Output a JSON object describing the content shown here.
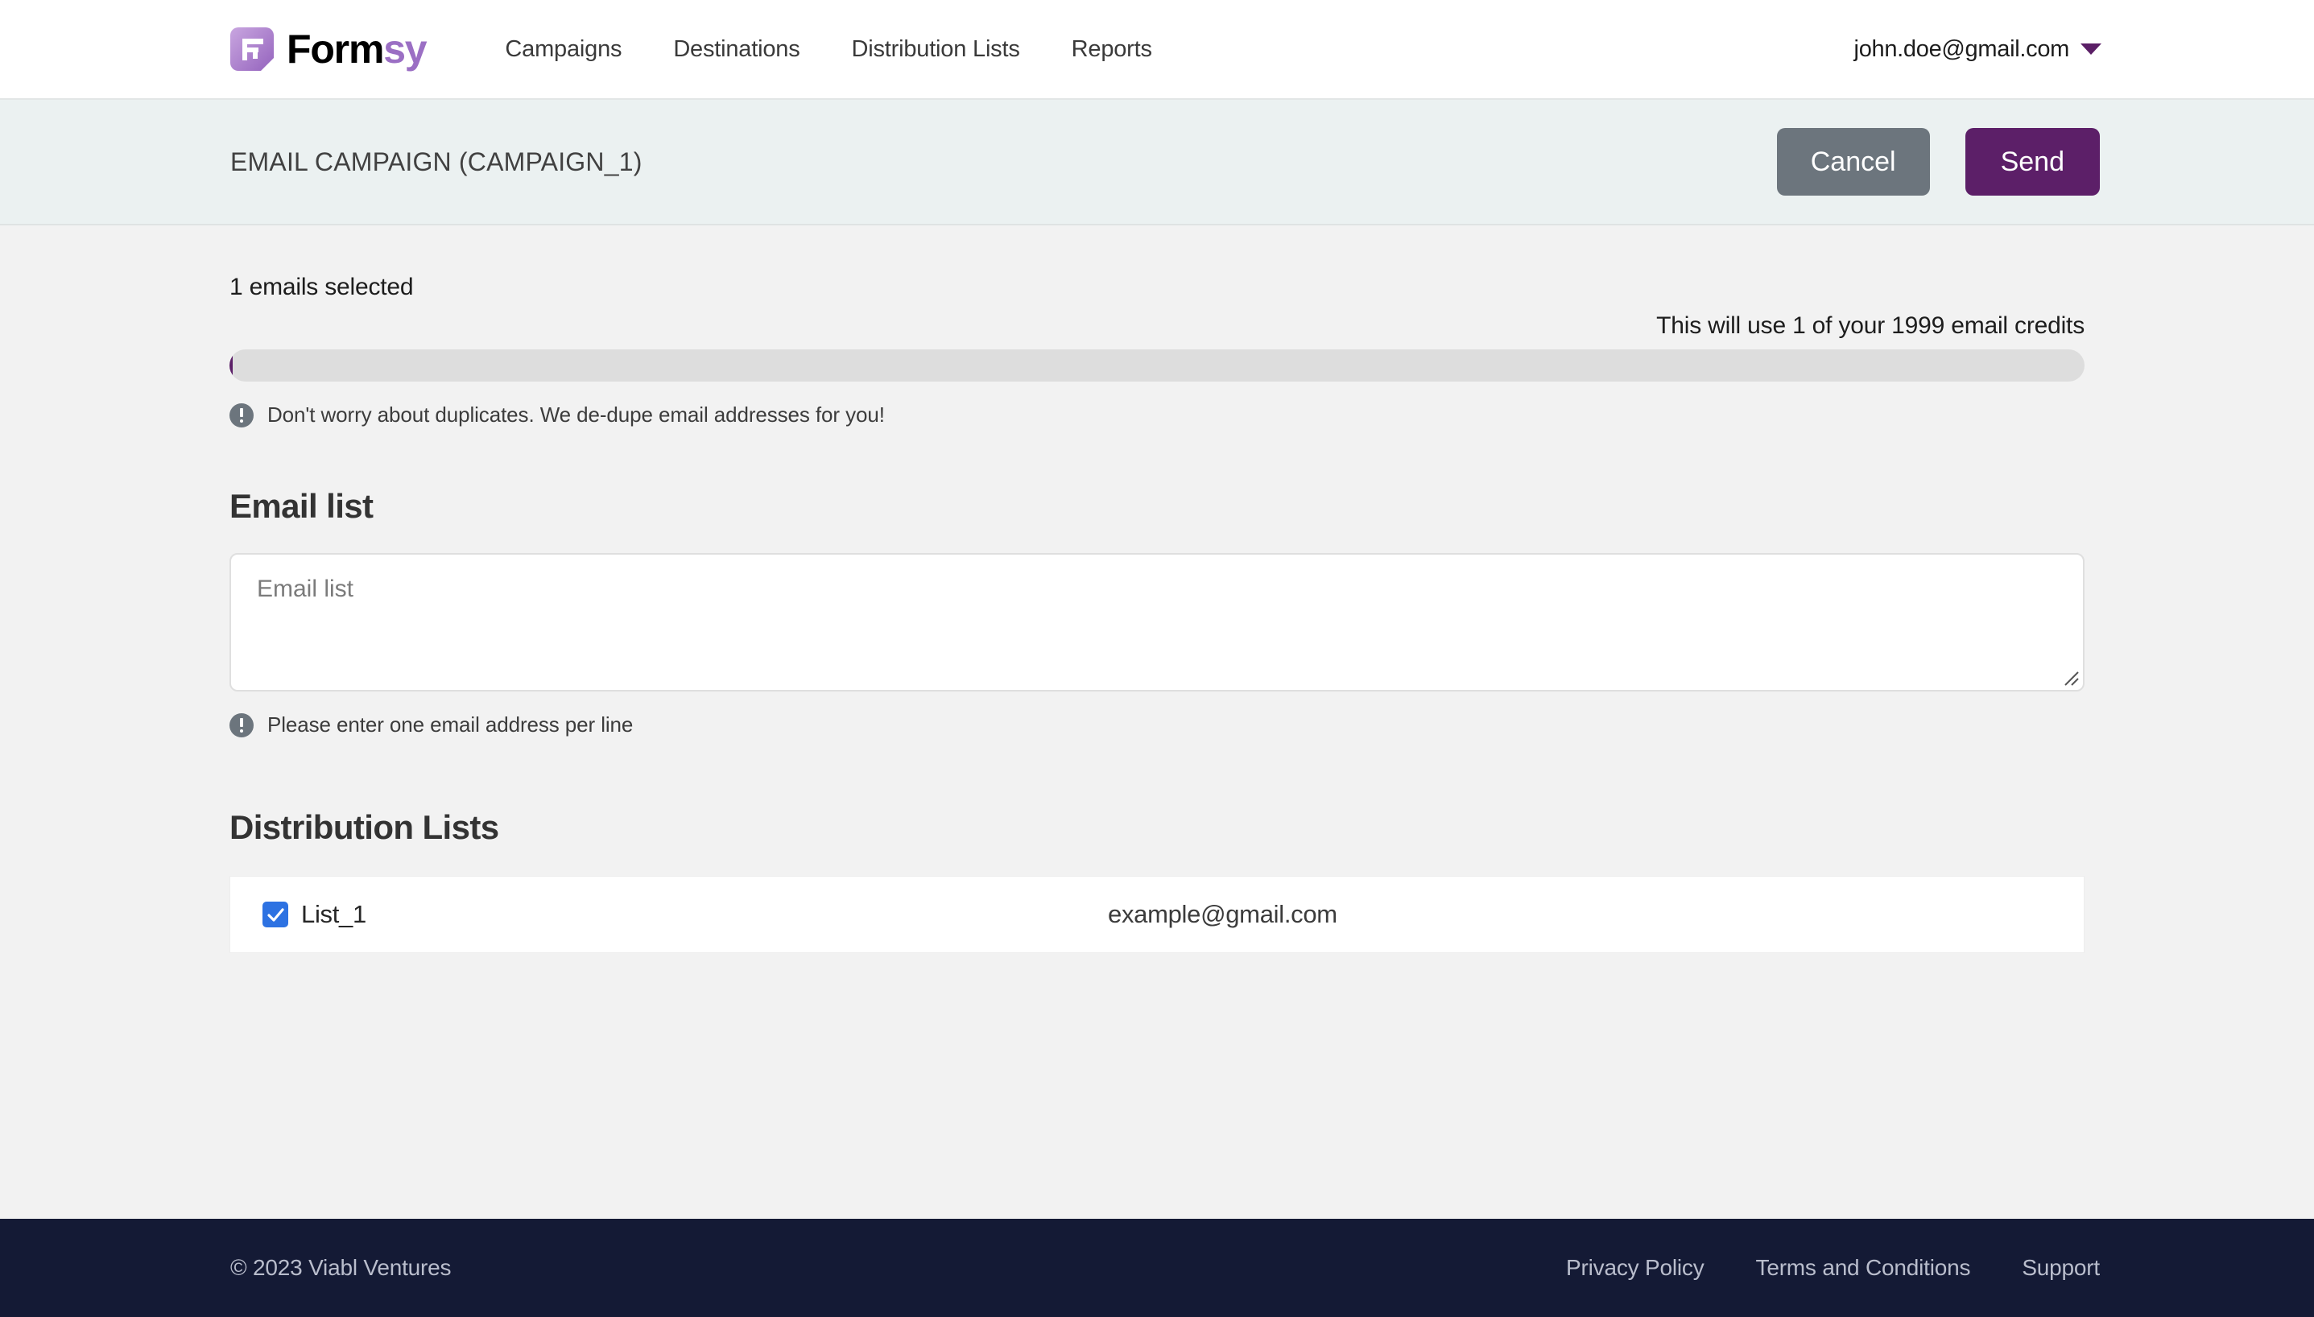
{
  "brand": {
    "word_dark": "Form",
    "word_accent": "sy",
    "logo_icon": "formsy-logo-icon",
    "accent_color": "#9b6fc4"
  },
  "nav": {
    "links": [
      {
        "label": "Campaigns"
      },
      {
        "label": "Destinations"
      },
      {
        "label": "Distribution Lists"
      },
      {
        "label": "Reports"
      }
    ]
  },
  "user": {
    "email": "john.doe@gmail.com",
    "caret_icon": "chevron-down-icon",
    "caret_color": "#5b1f66"
  },
  "actionbar": {
    "title": "EMAIL CAMPAIGN (CAMPAIGN_1)",
    "cancel_label": "Cancel",
    "send_label": "Send",
    "cancel_color": "#6c757d",
    "send_color": "#5c1f68"
  },
  "credits": {
    "selected_text": "1 emails selected",
    "usage_text": "This will use 1 of your 1999 email credits",
    "progress_percent": "0.05",
    "progress_fill_color": "#5c1f68",
    "progress_track_color": "#dddddd",
    "duplicate_hint": "Don't worry about duplicates. We de-dupe email addresses for you!",
    "info_icon": "info-circle-icon"
  },
  "email_list": {
    "heading": "Email list",
    "placeholder": "Email list",
    "value": "",
    "hint": "Please enter one email address per line",
    "info_icon": "info-circle-icon",
    "resize_icon": "resize-handle-icon"
  },
  "distribution_lists": {
    "heading": "Distribution Lists",
    "rows": [
      {
        "name": "List_1",
        "email": "example@gmail.com",
        "checked": true
      }
    ],
    "checkbox_color": "#2d72e2"
  },
  "footer": {
    "copyright": "© 2023 Viabl Ventures",
    "links": [
      {
        "label": "Privacy Policy"
      },
      {
        "label": "Terms and Conditions"
      },
      {
        "label": "Support"
      }
    ],
    "background": "#141a35"
  }
}
